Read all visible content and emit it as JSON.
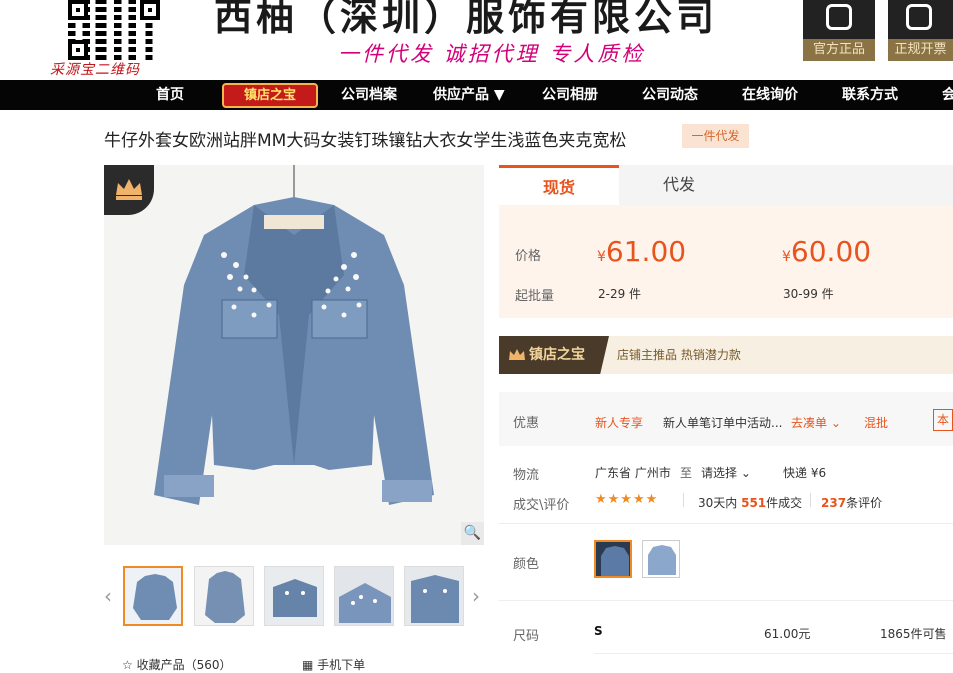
{
  "header": {
    "qr_caption": "采源宝二维码",
    "company_name": "西柚（深圳）服饰有限公司",
    "slogan": "一件代发 诚招代理 专人质检",
    "badges": [
      "官方正品",
      "正规开票"
    ]
  },
  "nav": {
    "items": [
      "首页",
      "公司档案",
      "供应产品 ▼",
      "公司相册",
      "公司动态",
      "在线询价",
      "联系方式",
      "会"
    ],
    "shop_badge": "镇店之宝"
  },
  "product": {
    "title": "牛仔外套女欧洲站胖MM大码女装钉珠镶钻大衣女学生浅蓝色夹克宽松",
    "oem_tag": "一件代发",
    "favorite": "收藏产品（560）",
    "mobile_order": "手机下单"
  },
  "tabs": {
    "spot": "现货",
    "proxy": "代发"
  },
  "pricing": {
    "price_label": "价格",
    "moq_label": "起批量",
    "currency": "¥",
    "tiers": [
      {
        "price": "61.00",
        "qty": "2-29 件"
      },
      {
        "price": "60.00",
        "qty": "30-99 件"
      }
    ]
  },
  "shop_bar": {
    "badge": "镇店之宝",
    "text": "店铺主推品  热销潜力款"
  },
  "promo": {
    "label": "优惠",
    "new_user": "新人专享",
    "desc": "新人单笔订单中活动...",
    "make_up": "去凑单",
    "mixed": "混批",
    "corner": "本"
  },
  "logistics": {
    "label": "物流",
    "from": "广东省 广州市",
    "to_word": "至",
    "select": "请选择",
    "express": "快递 ¥6"
  },
  "deal": {
    "label": "成交\\评价",
    "stars": "★★★★★",
    "days_prefix": "30天内",
    "count": "551",
    "count_suffix": "件成交",
    "reviews": "237",
    "reviews_suffix": "条评价"
  },
  "color": {
    "label": "颜色"
  },
  "size": {
    "label": "尺码",
    "value": "S",
    "price": "61.00元",
    "stock": "1865件可售"
  },
  "colors": {
    "accent": "#e7541d",
    "nav_bg": "#050505",
    "slogan": "#d4007a"
  }
}
